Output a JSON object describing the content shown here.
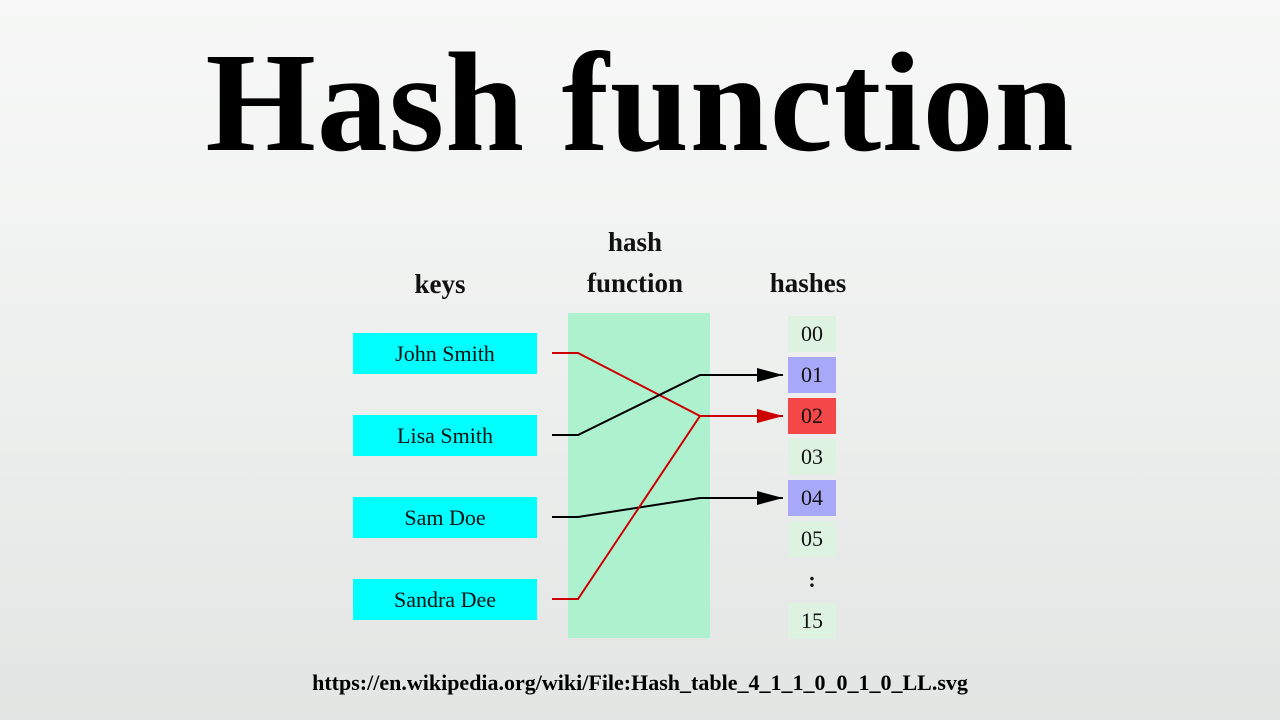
{
  "title": "Hash function",
  "headers": {
    "keys": "keys",
    "hash_function": [
      "hash",
      "function"
    ],
    "hashes": "hashes"
  },
  "keys": [
    "John Smith",
    "Lisa Smith",
    "Sam Doe",
    "Sandra Dee"
  ],
  "buckets": [
    {
      "label": "00",
      "state": "empty"
    },
    {
      "label": "01",
      "state": "blue"
    },
    {
      "label": "02",
      "state": "red"
    },
    {
      "label": "03",
      "state": "empty"
    },
    {
      "label": "04",
      "state": "blue"
    },
    {
      "label": "05",
      "state": "empty"
    },
    {
      "label": ":",
      "state": "dots"
    },
    {
      "label": "15",
      "state": "empty"
    }
  ],
  "mappings": [
    {
      "key": "John Smith",
      "bucket": "02",
      "color": "#cc0000"
    },
    {
      "key": "Lisa Smith",
      "bucket": "01",
      "color": "#000000"
    },
    {
      "key": "Sam Doe",
      "bucket": "04",
      "color": "#000000"
    },
    {
      "key": "Sandra Dee",
      "bucket": "02",
      "color": "#cc0000"
    }
  ],
  "colors": {
    "key_fill": "#00ffff",
    "hash_function_fill": "#adf1cf",
    "bucket_empty": "#def2e2",
    "bucket_single": "#a8a8f8",
    "bucket_collision": "#f44848",
    "arrow_normal": "#000000",
    "arrow_collision": "#cc0000"
  },
  "source_url": "https://en.wikipedia.org/wiki/File:Hash_table_4_1_1_0_0_1_0_LL.svg"
}
